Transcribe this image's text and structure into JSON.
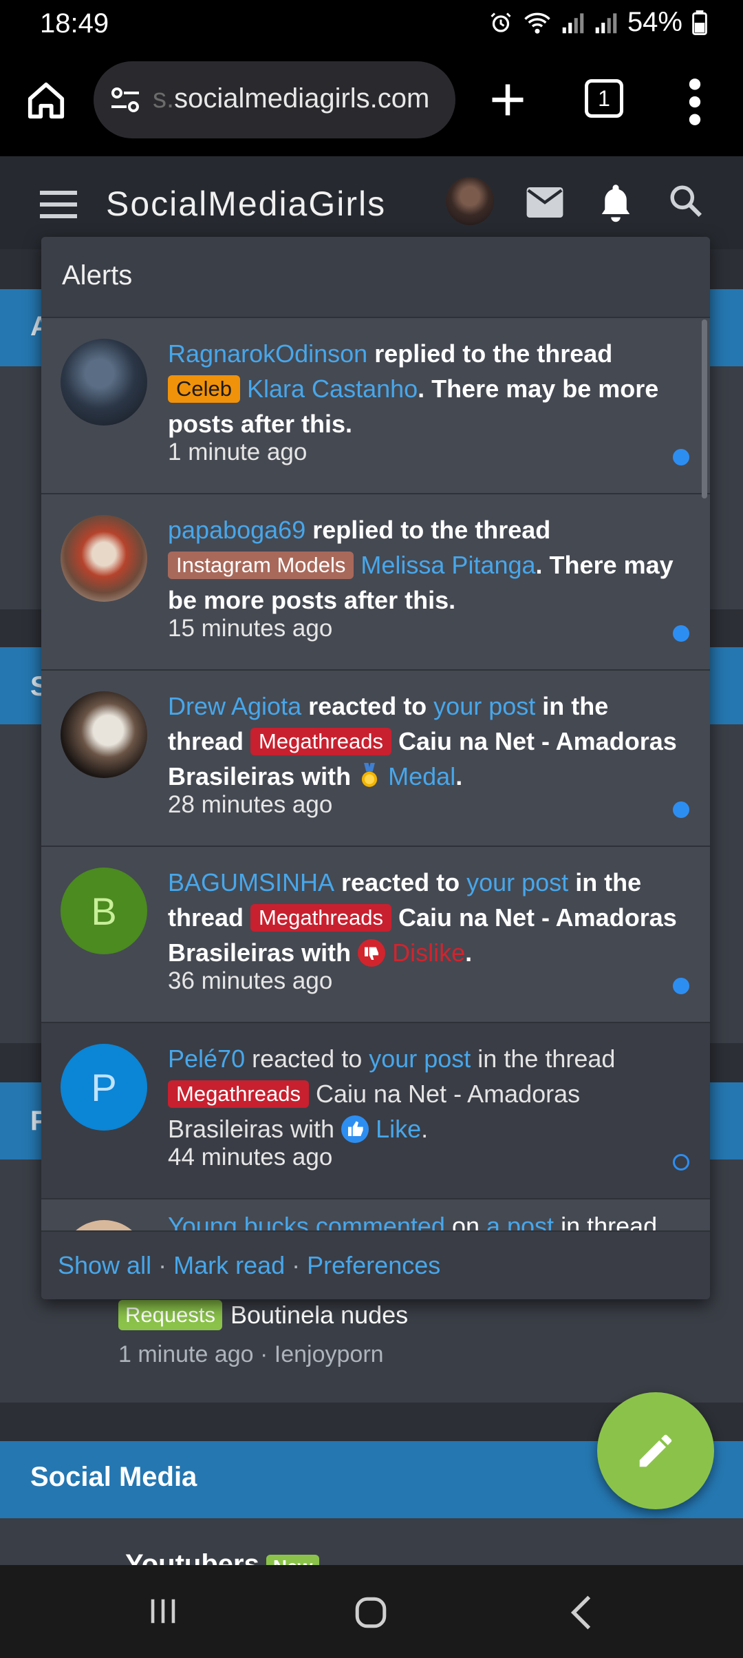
{
  "status": {
    "time": "18:49",
    "battery": "54%"
  },
  "browser": {
    "url_prefix": "s.",
    "url_domain": "socialmediagirls.com",
    "tab_count": "1"
  },
  "site": {
    "name": "SocialMediaGirls"
  },
  "alerts": {
    "title": "Alerts",
    "items": [
      {
        "user": "RagnarokOdinson",
        "action": " replied to the thread ",
        "tag": "Celeb",
        "thread": "Klara Castanho",
        "tail": ". There may be more posts after this.",
        "time": "1 minute ago",
        "unread": true
      },
      {
        "user": "papaboga69",
        "action": " replied to the thread ",
        "tag": "Instagram Models",
        "thread": "Melissa Pitanga",
        "tail": ". There may be more posts after this.",
        "time": "15 minutes ago",
        "unread": true
      },
      {
        "user": "Drew Agiota",
        "action": " reacted to ",
        "post_link": "your post",
        "mid": " in the thread ",
        "tag": "Megathreads",
        "thread": " Caiu na Net - Amadoras Brasileiras with ",
        "reaction": "Medal",
        "tail": ".",
        "time": "28 minutes ago",
        "unread": true
      },
      {
        "user": "BAGUMSINHA",
        "avatar_letter": "B",
        "action": " reacted to ",
        "post_link": "your post",
        "mid": " in the thread ",
        "tag": "Megathreads",
        "thread": " Caiu na Net - Amadoras Brasileiras with ",
        "reaction": "Dislike",
        "tail": ".",
        "time": "36 minutes ago",
        "unread": true
      },
      {
        "user": "Pelé70",
        "avatar_letter": "P",
        "action": " reacted to ",
        "post_link": "your post",
        "mid": " in the thread ",
        "tag": "Megathreads",
        "thread": " Caiu na Net - Amadoras Brasileiras with ",
        "reaction": "Like",
        "tail": ".",
        "time": "44 minutes ago",
        "unread": false
      }
    ],
    "partial": {
      "user": "Young bucks commented",
      "mid": " on ",
      "link": "a post",
      "rest": " in thread"
    },
    "footer": {
      "show_all": "Show all",
      "sep": " · ",
      "mark_read": "Mark read",
      "preferences": "Preferences"
    }
  },
  "background": {
    "section_letters": [
      "A",
      "S",
      "P"
    ],
    "request_tag": "Requests",
    "request_title": "Boutinela nudes",
    "request_meta": "1 minute ago · Ienjoyporn",
    "social_media": "Social Media",
    "youtubers": "Youtubers",
    "new_tag": "New"
  },
  "colors": {
    "accent": "#47a7eb",
    "header_bar": "#2577b1",
    "fab": "#8bc34a"
  },
  "icons": [
    "home-icon",
    "tune-icon",
    "plus-icon",
    "tabs-icon",
    "more-vert-icon",
    "hamburger-icon",
    "mail-icon",
    "bell-icon",
    "search-icon",
    "edit-icon",
    "medal-icon",
    "dislike-icon",
    "like-icon"
  ]
}
